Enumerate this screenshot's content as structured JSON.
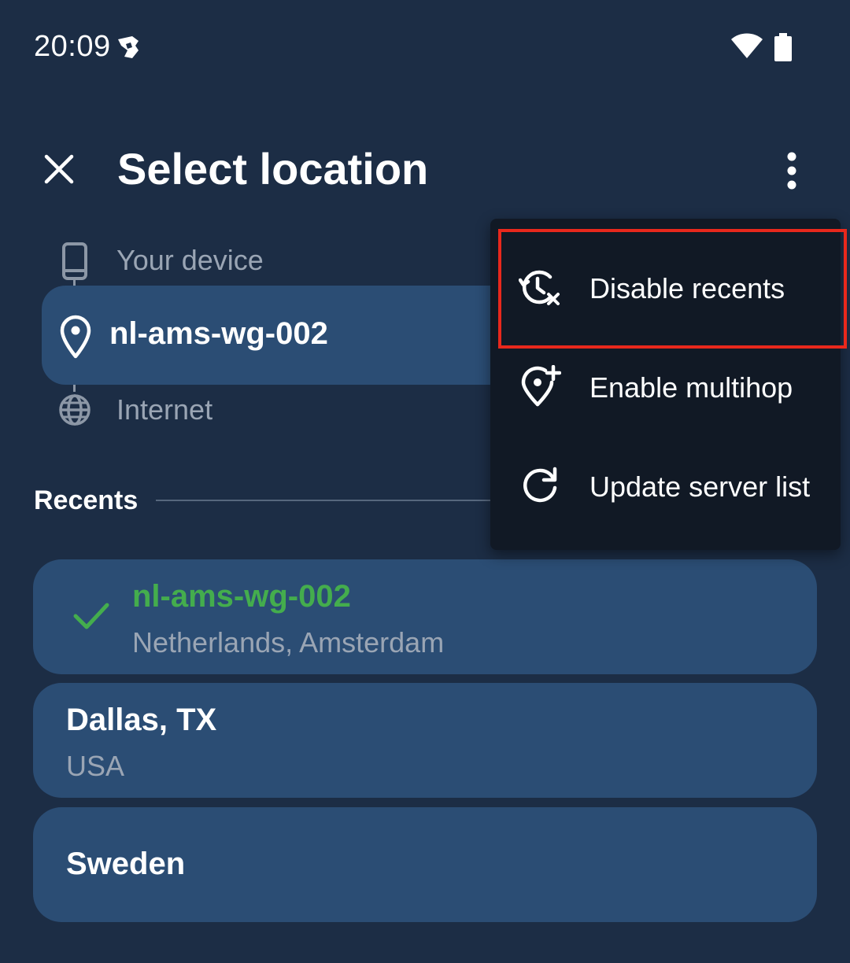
{
  "status_bar": {
    "time": "20:09"
  },
  "header": {
    "title": "Select location"
  },
  "connection_path": {
    "device_label": "Your device",
    "server_label": "nl-ams-wg-002",
    "internet_label": "Internet"
  },
  "recents": {
    "title": "Recents",
    "items": [
      {
        "title": "nl-ams-wg-002",
        "subtitle": "Netherlands, Amsterdam",
        "selected": true
      },
      {
        "title": "Dallas, TX",
        "subtitle": "USA",
        "selected": false
      },
      {
        "title": "Sweden",
        "subtitle": "",
        "selected": false
      }
    ]
  },
  "menu": {
    "items": [
      {
        "label": "Disable recents",
        "icon": "history-off-icon"
      },
      {
        "label": "Enable multihop",
        "icon": "location-add-icon"
      },
      {
        "label": "Update server list",
        "icon": "refresh-icon"
      }
    ]
  },
  "colors": {
    "background": "#1c2d45",
    "card": "#2b4d74",
    "menu": "#111925",
    "selected_text": "#44ad4d",
    "highlight": "#e8281c"
  }
}
